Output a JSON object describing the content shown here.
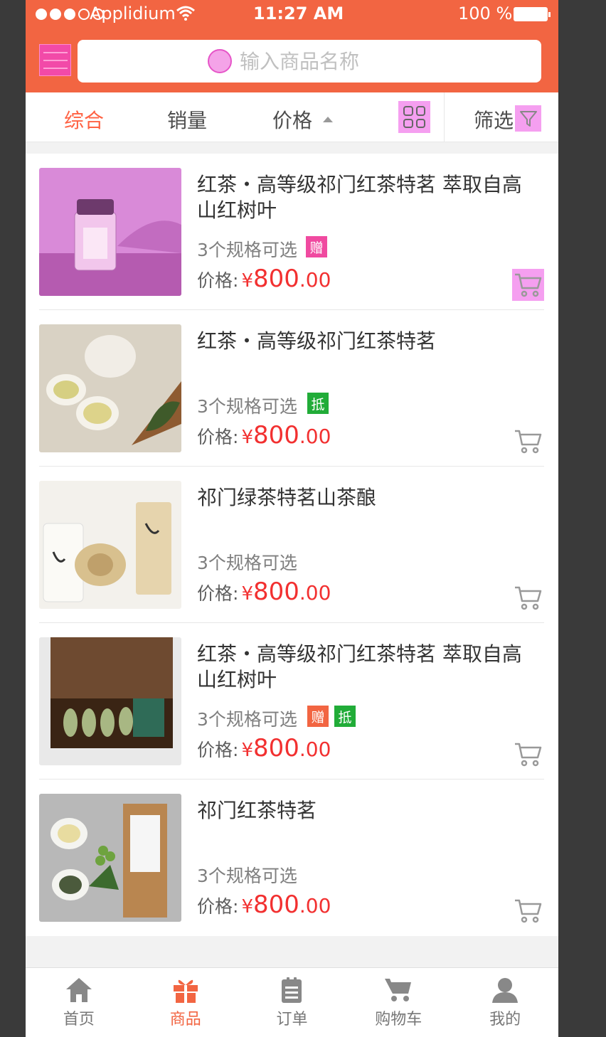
{
  "status_bar": {
    "carrier": "Applidium",
    "time": "11:27 AM",
    "battery": "100 %"
  },
  "search": {
    "placeholder": "输入商品名称"
  },
  "sort_tabs": [
    {
      "label": "综合"
    },
    {
      "label": "销量"
    },
    {
      "label": "价格"
    },
    {
      "label": "筛选"
    }
  ],
  "colors": {
    "brand": "#f26542",
    "active_tab": "#ff6243",
    "price": "#f23030",
    "gift_badge": "#f26542",
    "offset_badge": "#21ac38",
    "separator": "#e7e7e7"
  },
  "products": [
    {
      "title": "红茶・高等级祁门红茶特茗  萃取自高山红树叶",
      "spec": "3个规格可选",
      "badges": [
        "赠"
      ],
      "price_label": "价格:",
      "currency": "¥",
      "price_int": "800",
      "price_dec": ".00"
    },
    {
      "title": "红茶・高等级祁门红茶特茗",
      "spec": "3个规格可选",
      "badges": [
        "抵"
      ],
      "price_label": "价格:",
      "currency": "¥",
      "price_int": "800",
      "price_dec": ".00"
    },
    {
      "title": "祁门绿茶特茗山茶酿",
      "spec": "3个规格可选",
      "badges": [],
      "price_label": "价格:",
      "currency": "¥",
      "price_int": "800",
      "price_dec": ".00"
    },
    {
      "title": "红茶・高等级祁门红茶特茗  萃取自高山红树叶",
      "spec": "3个规格可选",
      "badges": [
        "赠",
        "抵"
      ],
      "price_label": "价格:",
      "currency": "¥",
      "price_int": "800",
      "price_dec": ".00"
    },
    {
      "title": "祁门红茶特茗",
      "spec": "3个规格可选",
      "badges": [],
      "price_label": "价格:",
      "currency": "¥",
      "price_int": "800",
      "price_dec": ".00"
    }
  ],
  "tabbar": [
    {
      "label": "首页",
      "icon": "home-icon"
    },
    {
      "label": "商品",
      "icon": "gift-icon"
    },
    {
      "label": "订单",
      "icon": "clipboard-icon"
    },
    {
      "label": "购物车",
      "icon": "cart-icon"
    },
    {
      "label": "我的",
      "icon": "user-icon"
    }
  ]
}
